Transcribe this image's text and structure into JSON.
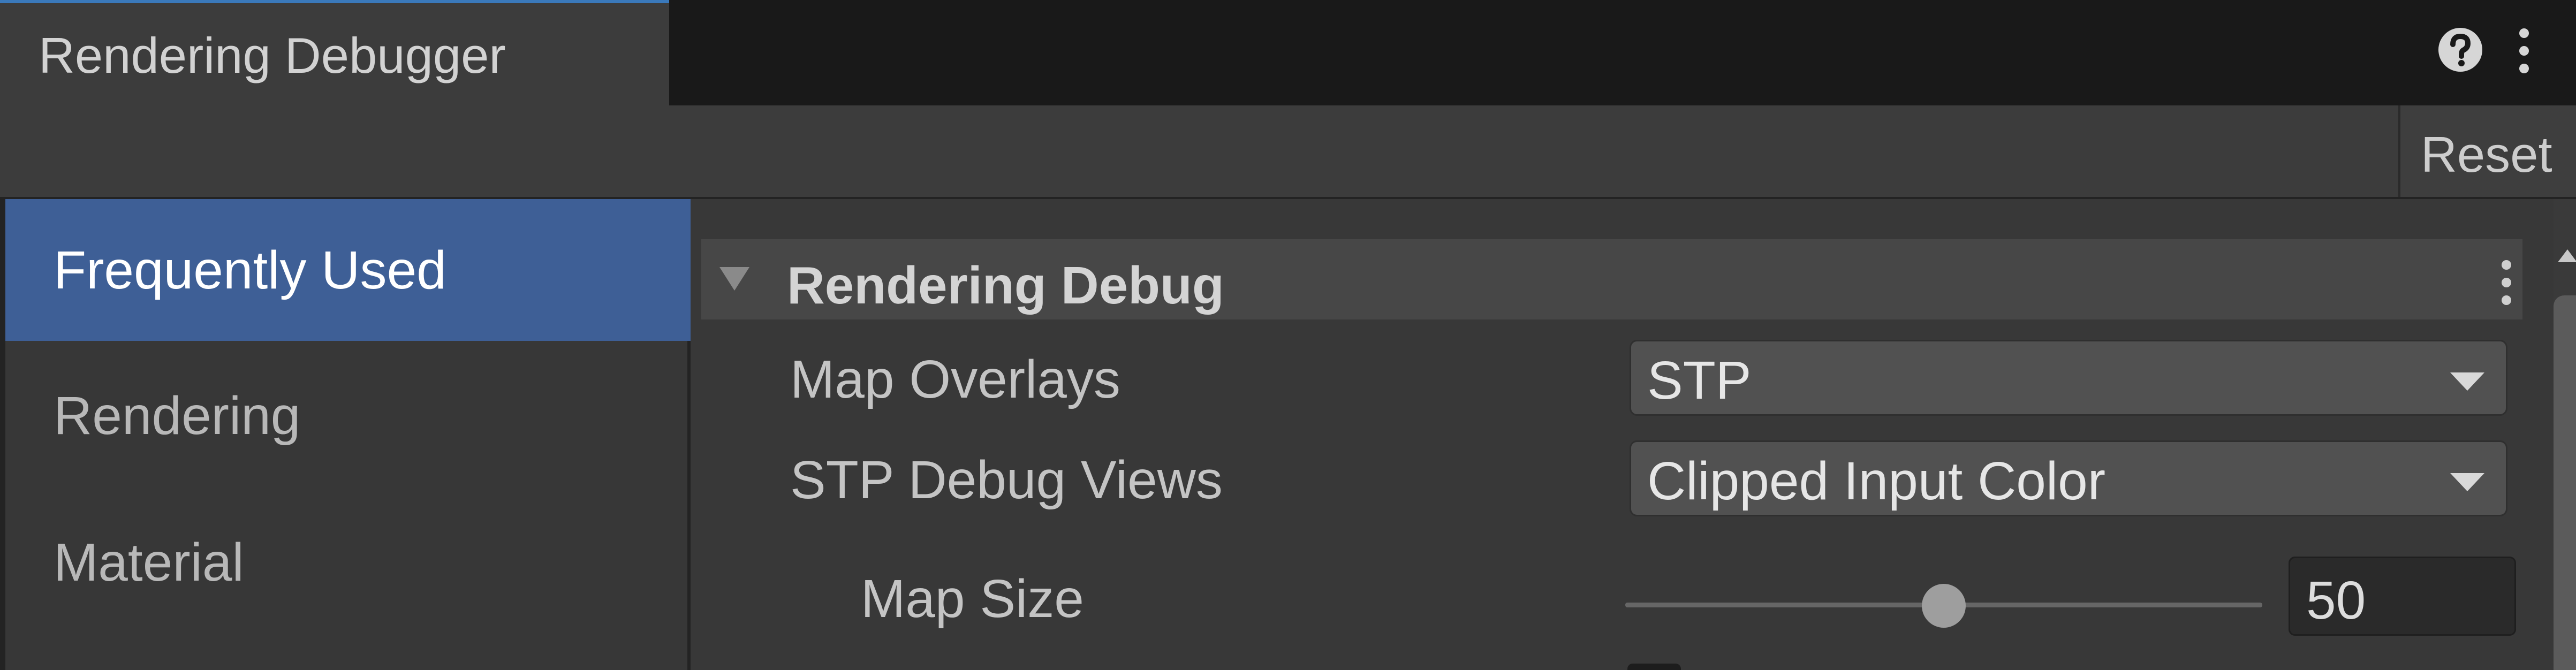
{
  "window": {
    "tab_title": "Rendering Debugger",
    "reset_label": "Reset"
  },
  "sidebar": {
    "items": [
      {
        "label": "Frequently Used",
        "selected": true
      },
      {
        "label": "Rendering",
        "selected": false
      },
      {
        "label": "Material",
        "selected": false
      }
    ]
  },
  "section": {
    "title": "Rendering Debug",
    "expanded": true
  },
  "fields": {
    "map_overlays": {
      "label": "Map Overlays",
      "value": "STP"
    },
    "stp_debug_views": {
      "label": "STP Debug Views",
      "value": "Clipped Input Color"
    },
    "map_size": {
      "label": "Map Size",
      "value": "50",
      "slider_fraction": 0.5
    }
  },
  "icons": {
    "help": "help-icon",
    "window_menu": "more-vertical-icon",
    "section_menu": "more-vertical-icon",
    "foldout": "foldout-triangle-icon",
    "dropdown": "chevron-down-icon",
    "scroll_up": "scroll-up-icon"
  },
  "colors": {
    "accent_tab_underline": "#3a79bb",
    "selected_item": "#3e5f96"
  }
}
